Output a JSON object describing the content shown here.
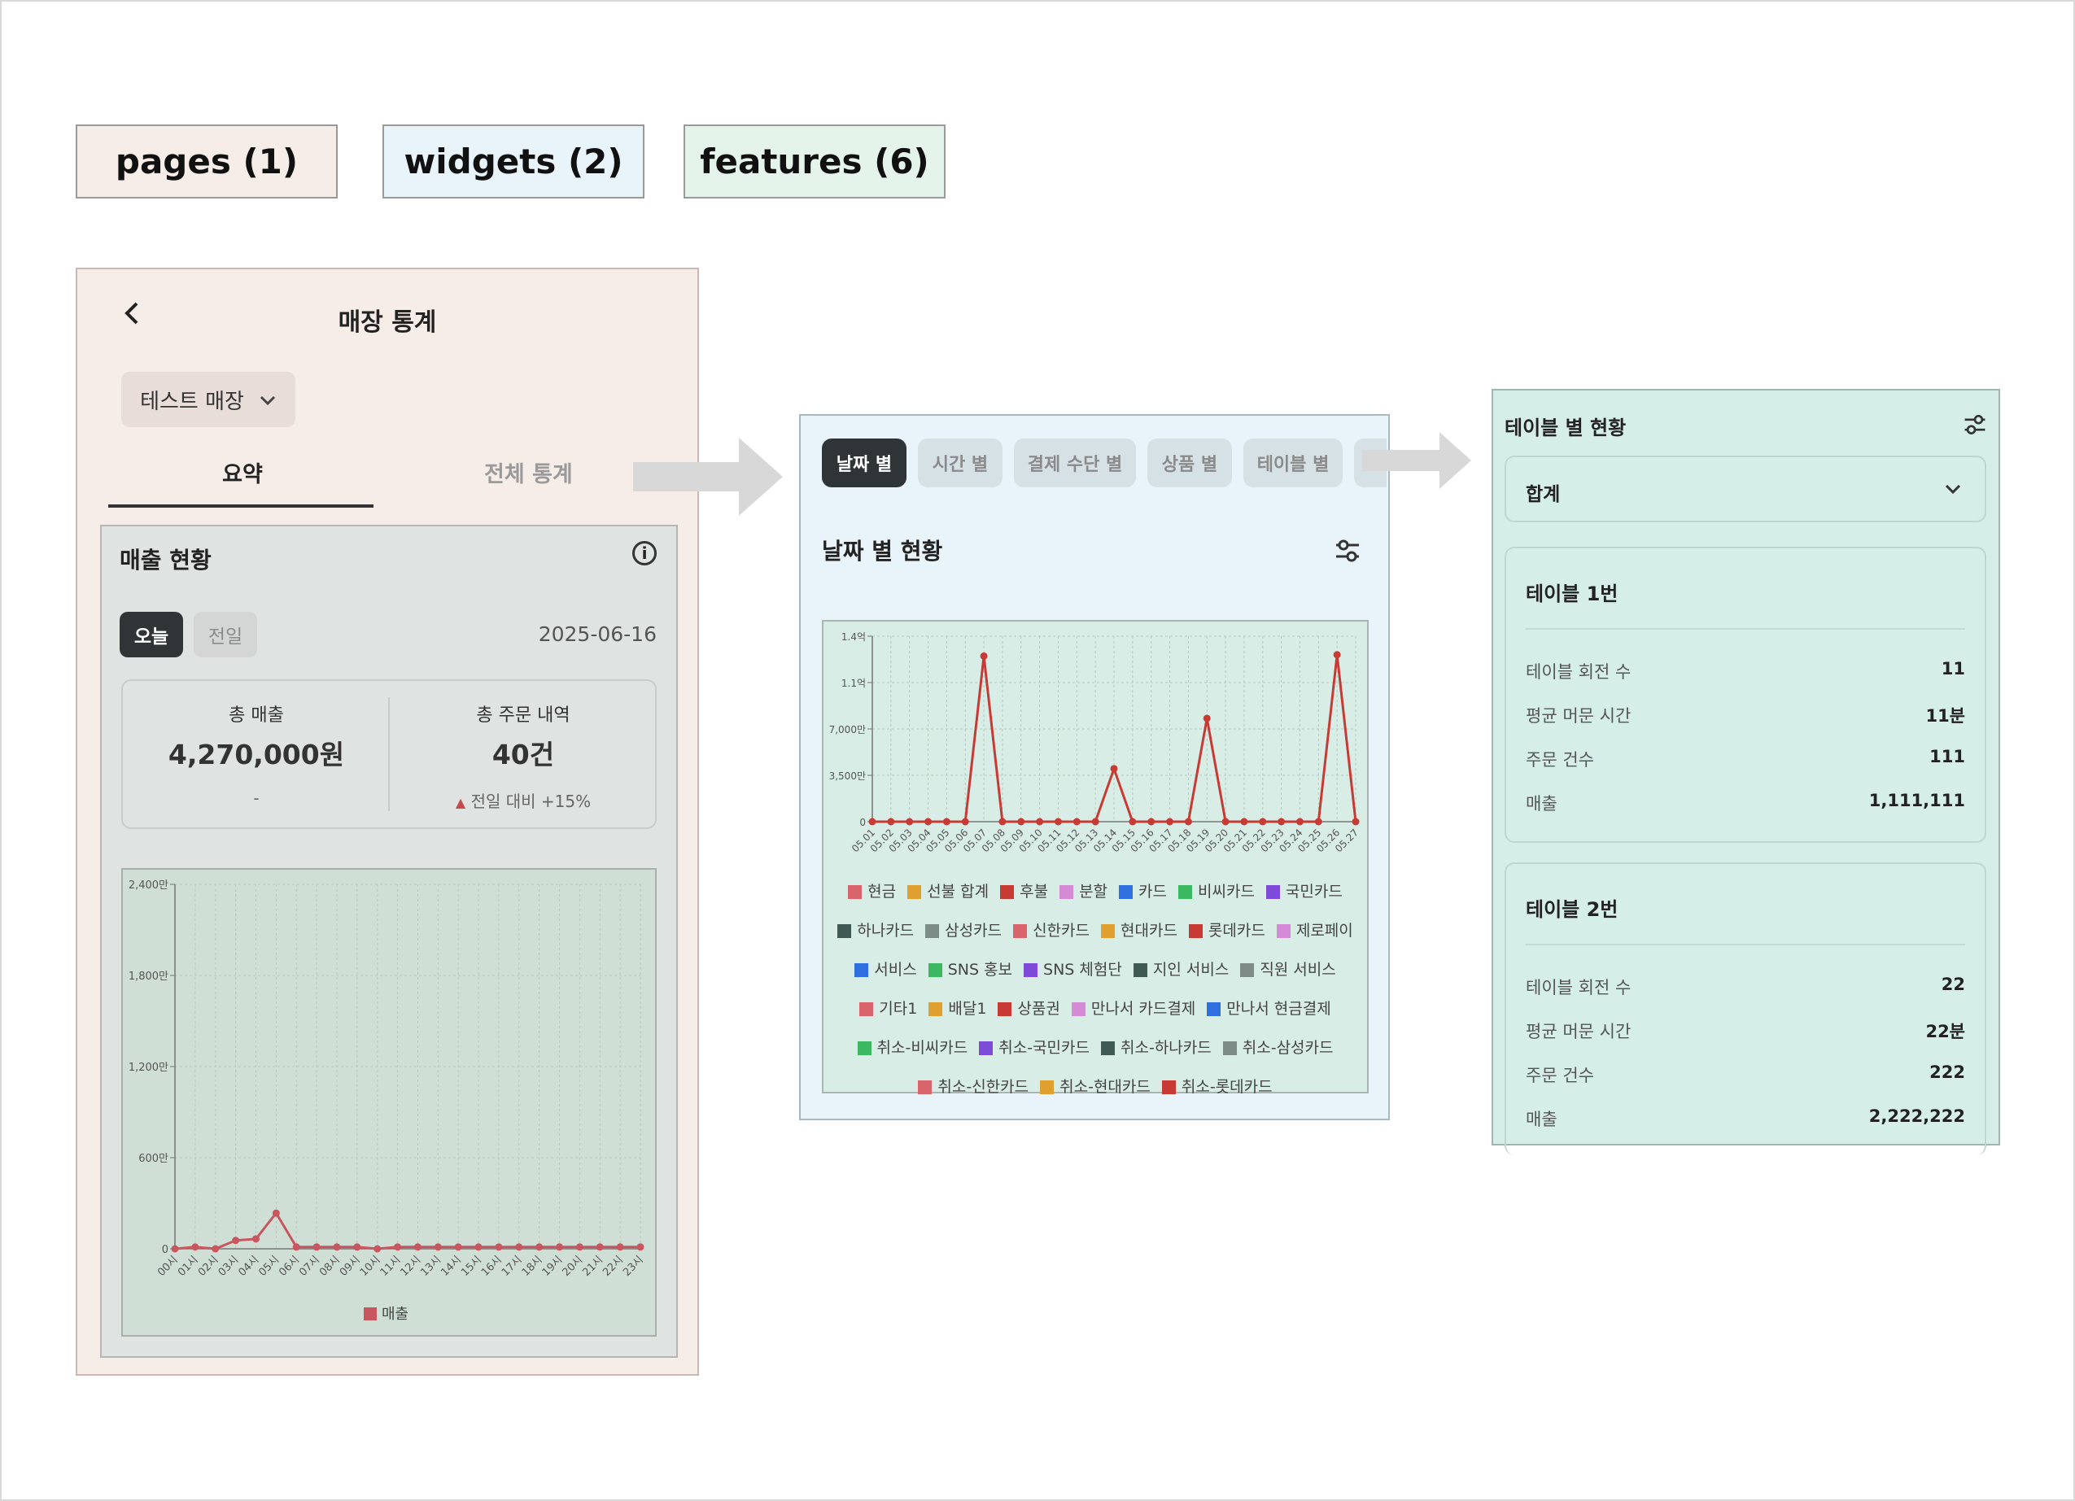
{
  "categories": [
    {
      "label": "pages (1)",
      "color": "#f6ece8"
    },
    {
      "label": "widgets (2)",
      "color": "#e8f3fa"
    },
    {
      "label": "features (6)",
      "color": "#e5f4eb"
    }
  ],
  "pages": {
    "back_icon": "chevron-left-icon",
    "title": "매장 통계",
    "store_select": "테스트 매장",
    "tabs": [
      {
        "label": "요약"
      },
      {
        "label": "전체 통계"
      }
    ],
    "summary": {
      "title": "매출 현황",
      "period_today": "오늘",
      "period_prev": "전일",
      "date": "2025-06-16",
      "total_sales_label": "총 매출",
      "total_sales_value": "4,270,000원",
      "total_sales_sub": "-",
      "total_orders_label": "총 주문 내역",
      "total_orders_value": "40건",
      "total_orders_sub": "전일 대비 +15%"
    }
  },
  "widgets": {
    "tabs": [
      {
        "label": "날짜 별"
      },
      {
        "label": "시간 별"
      },
      {
        "label": "결제 수단 별"
      },
      {
        "label": "상품 별"
      },
      {
        "label": "테이블 별"
      }
    ],
    "title": "날짜 별 현황",
    "legend": [
      {
        "name": "현금",
        "color": "#d9646c"
      },
      {
        "name": "선불 합계",
        "color": "#e0a030"
      },
      {
        "name": "후불",
        "color": "#c83b35"
      },
      {
        "name": "분할",
        "color": "#d58ad6"
      },
      {
        "name": "카드",
        "color": "#2f6fe0"
      },
      {
        "name": "비씨카드",
        "color": "#3db862"
      },
      {
        "name": "국민카드",
        "color": "#7e4bd9"
      },
      {
        "name": "하나카드",
        "color": "#3f5a52"
      },
      {
        "name": "삼성카드",
        "color": "#7e8c88"
      },
      {
        "name": "신한카드",
        "color": "#d9646c"
      },
      {
        "name": "현대카드",
        "color": "#e0a030"
      },
      {
        "name": "롯데카드",
        "color": "#c83b35"
      },
      {
        "name": "제로페이",
        "color": "#d58ad6"
      },
      {
        "name": "서비스",
        "color": "#2f6fe0"
      },
      {
        "name": "SNS 홍보",
        "color": "#3db862"
      },
      {
        "name": "SNS 체험단",
        "color": "#7e4bd9"
      },
      {
        "name": "지인 서비스",
        "color": "#3f5a52"
      },
      {
        "name": "직원 서비스",
        "color": "#7e8c88"
      },
      {
        "name": "기타1",
        "color": "#d9646c"
      },
      {
        "name": "배달1",
        "color": "#e0a030"
      },
      {
        "name": "상품권",
        "color": "#c83b35"
      },
      {
        "name": "만나서 카드결제",
        "color": "#d58ad6"
      },
      {
        "name": "만나서 현금결제",
        "color": "#2f6fe0"
      },
      {
        "name": "취소-비씨카드",
        "color": "#3db862"
      },
      {
        "name": "취소-국민카드",
        "color": "#7e4bd9"
      },
      {
        "name": "취소-하나카드",
        "color": "#3f5a52"
      },
      {
        "name": "취소-삼성카드",
        "color": "#7e8c88"
      },
      {
        "name": "취소-신한카드",
        "color": "#d9646c"
      },
      {
        "name": "취소-현대카드",
        "color": "#e0a030"
      },
      {
        "name": "취소-롯데카드",
        "color": "#c83b35"
      }
    ]
  },
  "features": {
    "title": "테이블 별 현황",
    "select_value": "합계",
    "tables": [
      {
        "name": "테이블 1번",
        "rows": [
          {
            "label": "테이블 회전 수",
            "value": "11"
          },
          {
            "label": "평균 머문 시간",
            "value": "11분"
          },
          {
            "label": "주문 건수",
            "value": "111"
          },
          {
            "label": "매출",
            "value": "1,111,111"
          }
        ]
      },
      {
        "name": "테이블 2번",
        "rows": [
          {
            "label": "테이블 회전 수",
            "value": "22"
          },
          {
            "label": "평균 머문 시간",
            "value": "22분"
          },
          {
            "label": "주문 건수",
            "value": "222"
          },
          {
            "label": "매출",
            "value": "2,222,222"
          }
        ]
      }
    ]
  },
  "chart_data": [
    {
      "type": "line",
      "title": "",
      "x": [
        "00시",
        "01시",
        "02시",
        "03시",
        "04시",
        "05시",
        "06시",
        "07시",
        "08시",
        "09시",
        "10시",
        "11시",
        "12시",
        "13시",
        "14시",
        "15시",
        "16시",
        "17시",
        "18시",
        "19시",
        "20시",
        "21시",
        "22시",
        "23시"
      ],
      "series": [
        {
          "name": "매출",
          "color": "#c9565e",
          "values": [
            0,
            120000,
            0,
            550000,
            650000,
            2350000,
            120000,
            120000,
            120000,
            120000,
            0,
            120000,
            120000,
            120000,
            120000,
            120000,
            120000,
            120000,
            120000,
            120000,
            120000,
            120000,
            120000,
            120000
          ]
        }
      ],
      "yticks": [
        "0",
        "600만",
        "1,200만",
        "1,800만",
        "2,400만"
      ],
      "ylim": [
        0,
        2400
      ],
      "y_unit": "만",
      "grid": true,
      "legend": "bottom"
    },
    {
      "type": "line",
      "title": "",
      "x": [
        "05.01",
        "05.02",
        "05.03",
        "05.04",
        "05.05",
        "05.06",
        "05.07",
        "05.08",
        "05.09",
        "05.10",
        "05.11",
        "05.12",
        "05.13",
        "05.14",
        "05.15",
        "05.16",
        "05.17",
        "05.18",
        "05.19",
        "05.20",
        "05.21",
        "05.22",
        "05.23",
        "05.24",
        "05.25",
        "05.26",
        "05.27"
      ],
      "series": [
        {
          "name": "후불",
          "color": "#c83b35",
          "values": [
            0,
            0,
            0,
            0,
            0,
            0,
            12500,
            0,
            0,
            0,
            0,
            0,
            0,
            4000,
            0,
            0,
            0,
            0,
            7800,
            0,
            0,
            0,
            0,
            0,
            0,
            12600,
            0,
            0
          ]
        }
      ],
      "yticks": [
        "0",
        "3,500만",
        "7,000만",
        "1.1억",
        "1.4억"
      ],
      "ylim": [
        0,
        14000
      ],
      "y_unit": "만",
      "grid": true,
      "legend": "bottom"
    }
  ]
}
